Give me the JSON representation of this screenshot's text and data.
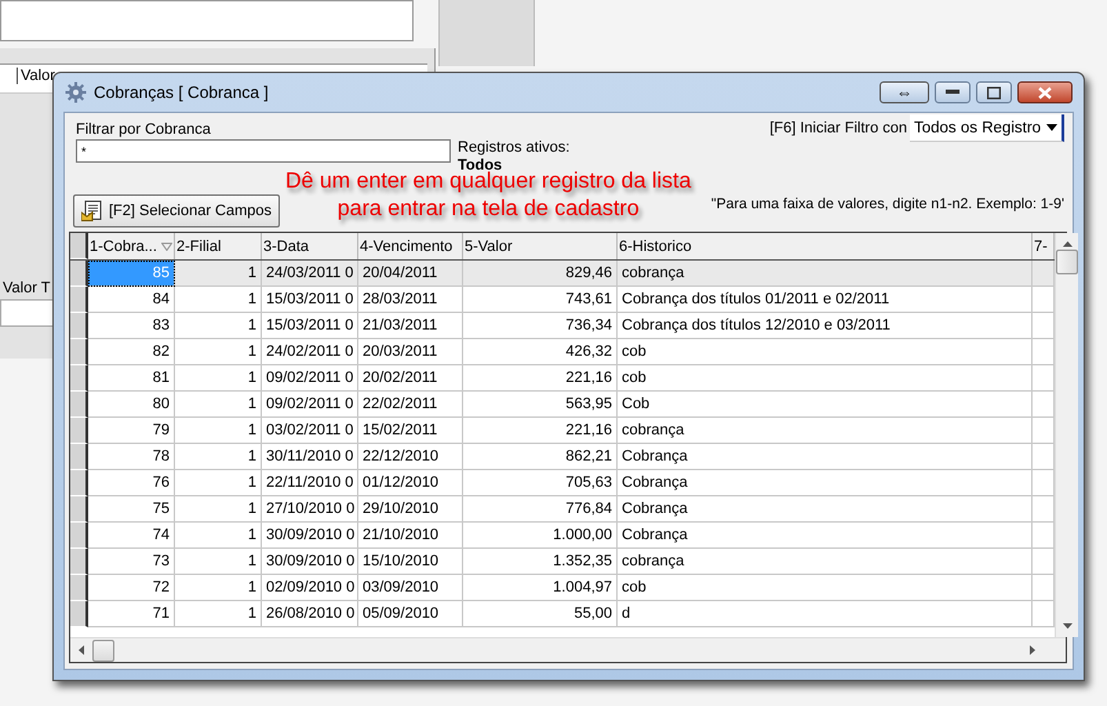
{
  "background_app": {
    "column_header": "Valor",
    "label": "Valor T"
  },
  "window": {
    "title": "Cobranças [ Cobranca ]",
    "extra_button": "⇔"
  },
  "filter": {
    "label": "Filtrar por Cobranca",
    "value": "*",
    "active_label": "Registros ativos:",
    "active_value": "Todos",
    "start_label": "[F6] Iniciar Filtro con",
    "start_value": "Todos os Registro",
    "hint": "\"Para uma faixa de valores, digite n1-n2. Exemplo: 1-9'"
  },
  "select_fields_button": "[F2]  Selecionar Campos",
  "annotation": [
    "Dê um enter em qualquer registro da lista",
    "para entrar na tela de cadastro"
  ],
  "table": {
    "columns": [
      "1-Cobra...",
      "2-Filial",
      "3-Data",
      "4-Vencimento",
      "5-Valor",
      "6-Historico",
      "7-"
    ],
    "rows": [
      {
        "cells": [
          "85",
          "1",
          "24/03/2011 0",
          "20/04/2011",
          "829,46",
          "cobrança"
        ],
        "selected": true
      },
      {
        "cells": [
          "84",
          "1",
          "15/03/2011 0",
          "28/03/2011",
          "743,61",
          "Cobrança dos títulos 01/2011 e 02/2011"
        ],
        "selected": false
      },
      {
        "cells": [
          "83",
          "1",
          "15/03/2011 0",
          "21/03/2011",
          "736,34",
          "Cobrança dos títulos 12/2010 e 03/2011"
        ],
        "selected": false
      },
      {
        "cells": [
          "82",
          "1",
          "24/02/2011 0",
          "20/03/2011",
          "426,32",
          "cob"
        ],
        "selected": false
      },
      {
        "cells": [
          "81",
          "1",
          "09/02/2011 0",
          "20/02/2011",
          "221,16",
          "cob"
        ],
        "selected": false
      },
      {
        "cells": [
          "80",
          "1",
          "09/02/2011 0",
          "22/02/2011",
          "563,95",
          "Cob"
        ],
        "selected": false
      },
      {
        "cells": [
          "79",
          "1",
          "03/02/2011 0",
          "15/02/2011",
          "221,16",
          "cobrança"
        ],
        "selected": false
      },
      {
        "cells": [
          "78",
          "1",
          "30/11/2010 0",
          "22/12/2010",
          "862,21",
          "Cobrança"
        ],
        "selected": false
      },
      {
        "cells": [
          "76",
          "1",
          "22/11/2010 0",
          "01/12/2010",
          "705,63",
          "Cobrança"
        ],
        "selected": false
      },
      {
        "cells": [
          "75",
          "1",
          "27/10/2010 0",
          "29/10/2010",
          "776,84",
          "Cobrança"
        ],
        "selected": false
      },
      {
        "cells": [
          "74",
          "1",
          "30/09/2010 0",
          "21/10/2010",
          "1.000,00",
          "Cobrança"
        ],
        "selected": false
      },
      {
        "cells": [
          "73",
          "1",
          "30/09/2010 0",
          "15/10/2010",
          "1.352,35",
          "cobrança"
        ],
        "selected": false
      },
      {
        "cells": [
          "72",
          "1",
          "02/09/2010 0",
          "03/09/2010",
          "1.004,97",
          "cob"
        ],
        "selected": false
      },
      {
        "cells": [
          "71",
          "1",
          "26/08/2010 0",
          "05/09/2010",
          "55,00",
          "d"
        ],
        "selected": false
      }
    ]
  }
}
